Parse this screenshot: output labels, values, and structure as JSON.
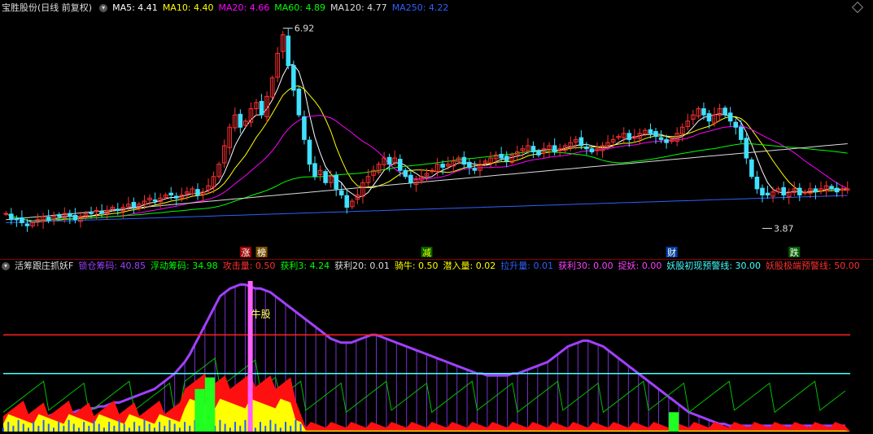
{
  "top_header": {
    "title": "宝胜股份(日线 前复权)",
    "items": [
      {
        "label": "MA5: 4.41",
        "color": "#ffffff"
      },
      {
        "label": "MA10: 4.40",
        "color": "#ffff00"
      },
      {
        "label": "MA20: 4.66",
        "color": "#ff00ff"
      },
      {
        "label": "MA60: 4.89",
        "color": "#00ff00"
      },
      {
        "label": "MA120: 4.77",
        "color": "#dddddd"
      },
      {
        "label": "MA250: 4.22",
        "color": "#3060ff"
      }
    ]
  },
  "sub_header": {
    "title": "活筹跟庄抓妖F",
    "items": [
      {
        "label": "锁仓筹码: 40.85",
        "color": "#a040ff"
      },
      {
        "label": "浮动筹码: 34.98",
        "color": "#00ff00"
      },
      {
        "label": "攻击量: 0.50",
        "color": "#ff3030"
      },
      {
        "label": "获利3: 4.24",
        "color": "#00ff00"
      },
      {
        "label": "获利20: 0.01",
        "color": "#dddddd"
      },
      {
        "label": "骑牛: 0.50",
        "color": "#ffff00"
      },
      {
        "label": "潜入量: 0.02",
        "color": "#ffff00"
      },
      {
        "label": "拉升量: 0.01",
        "color": "#3060ff"
      },
      {
        "label": "获利30: 0.00",
        "color": "#ff40ff"
      },
      {
        "label": "捉妖: 0.00",
        "color": "#ff40ff"
      },
      {
        "label": "妖股初现预警线: 30.00",
        "color": "#40ffff"
      },
      {
        "label": "妖股极端预警线: 50.00",
        "color": "#ff3030"
      }
    ]
  },
  "markers": [
    {
      "text": "涨",
      "bg": "#a00000",
      "fg": "#ffffff",
      "idx": 45
    },
    {
      "text": "榜",
      "bg": "#7a5200",
      "fg": "#ffffff",
      "idx": 48
    },
    {
      "text": "减",
      "bg": "#006000",
      "fg": "#ffff00",
      "idx": 79
    },
    {
      "text": "财",
      "bg": "#0040a0",
      "fg": "#ffffff",
      "idx": 125
    },
    {
      "text": "跌",
      "bg": "#006000",
      "fg": "#ffffff",
      "idx": 148
    }
  ],
  "signal_label": "牛股",
  "chart_data": {
    "type": "candlestick",
    "price_range": [
      3.5,
      7.2
    ],
    "high_label": "6.92",
    "low_label": "3.87",
    "bars": 170,
    "close_series": [
      4.0,
      3.9,
      3.9,
      3.85,
      3.8,
      3.85,
      3.9,
      3.95,
      3.9,
      3.95,
      3.95,
      4.0,
      3.95,
      3.9,
      3.95,
      4.0,
      4.0,
      4.05,
      4.0,
      4.05,
      4.1,
      4.05,
      4.1,
      4.15,
      4.1,
      4.15,
      4.2,
      4.25,
      4.2,
      4.25,
      4.3,
      4.3,
      4.25,
      4.3,
      4.35,
      4.4,
      4.3,
      4.35,
      4.45,
      4.6,
      4.8,
      5.1,
      5.4,
      5.6,
      5.4,
      5.5,
      5.7,
      5.8,
      5.6,
      5.9,
      6.2,
      6.6,
      6.9,
      6.4,
      6.0,
      5.6,
      5.2,
      4.8,
      4.6,
      4.7,
      4.5,
      4.6,
      4.4,
      4.3,
      4.1,
      4.2,
      4.3,
      4.5,
      4.6,
      4.7,
      4.8,
      4.9,
      4.8,
      4.9,
      4.7,
      4.6,
      4.5,
      4.55,
      4.6,
      4.65,
      4.7,
      4.8,
      4.75,
      4.8,
      4.85,
      4.9,
      4.8,
      4.75,
      4.7,
      4.8,
      4.85,
      4.9,
      4.95,
      4.9,
      4.85,
      4.95,
      5.0,
      5.05,
      5.1,
      5.0,
      4.95,
      5.05,
      5.1,
      5.0,
      5.05,
      5.1,
      5.15,
      5.2,
      5.1,
      5.05,
      5.0,
      5.05,
      5.1,
      5.15,
      5.2,
      5.25,
      5.3,
      5.2,
      5.25,
      5.3,
      5.35,
      5.3,
      5.25,
      5.2,
      5.15,
      5.2,
      5.3,
      5.4,
      5.5,
      5.6,
      5.7,
      5.6,
      5.5,
      5.6,
      5.7,
      5.6,
      5.5,
      5.4,
      5.2,
      4.9,
      4.6,
      4.4,
      4.3,
      4.3,
      4.35,
      4.4,
      4.3,
      4.35,
      4.4,
      4.3,
      4.35,
      4.4,
      4.35,
      4.4,
      4.45,
      4.4,
      4.35,
      4.4,
      4.4
    ],
    "ma_series": [
      {
        "name": "MA5",
        "color": "#ffffff"
      },
      {
        "name": "MA10",
        "color": "#ffff00"
      },
      {
        "name": "MA20",
        "color": "#ff00ff"
      },
      {
        "name": "MA60",
        "color": "#00ff00"
      },
      {
        "name": "MA120",
        "color": "#dddddd"
      },
      {
        "name": "MA250",
        "color": "#3060ff"
      }
    ],
    "indicator": {
      "lock_chips": [
        5,
        6,
        6,
        6,
        7,
        7,
        7,
        8,
        8,
        8,
        9,
        9,
        9,
        10,
        10,
        11,
        11,
        12,
        12,
        13,
        13,
        14,
        15,
        15,
        16,
        17,
        18,
        19,
        20,
        21,
        22,
        24,
        26,
        28,
        30,
        33,
        36,
        40,
        45,
        50,
        55,
        60,
        65,
        70,
        72,
        74,
        75,
        76,
        76,
        75,
        74,
        74,
        73,
        72,
        70,
        68,
        66,
        64,
        62,
        60,
        58,
        56,
        54,
        52,
        50,
        48,
        47,
        46,
        46,
        46,
        47,
        48,
        49,
        50,
        50,
        49,
        48,
        47,
        46,
        45,
        44,
        43,
        42,
        41,
        40,
        39,
        38,
        37,
        36,
        35,
        34,
        33,
        32,
        31,
        30,
        30,
        29,
        29,
        29,
        29,
        29,
        30,
        30,
        31,
        32,
        33,
        34,
        35,
        36,
        38,
        40,
        42,
        44,
        45,
        46,
        47,
        47,
        46,
        45,
        44,
        42,
        40,
        38,
        36,
        34,
        32,
        30,
        28,
        26,
        24,
        22,
        20,
        18,
        16,
        14,
        12,
        10,
        9,
        8,
        7,
        6,
        5,
        4,
        4,
        3,
        3,
        3,
        3,
        3,
        3,
        3,
        3,
        3,
        3,
        3,
        3,
        3,
        3,
        3,
        3,
        3,
        3,
        3,
        3,
        3,
        3,
        3,
        3
      ],
      "warn_line_1": 30,
      "warn_line_2": 50
    }
  }
}
